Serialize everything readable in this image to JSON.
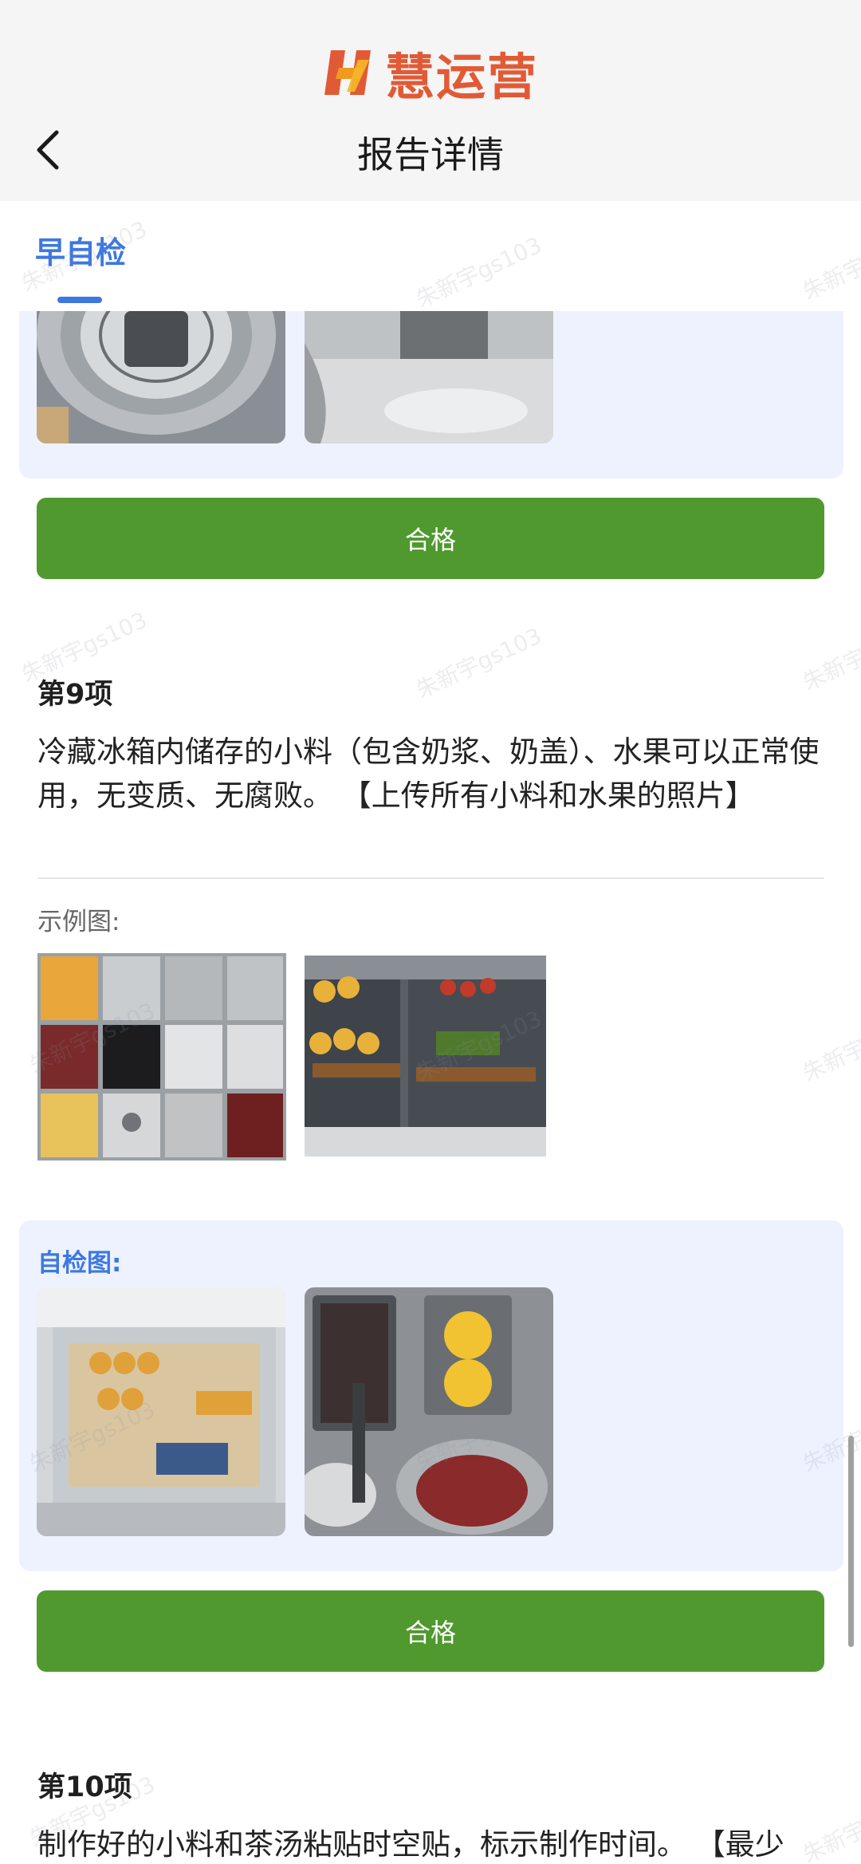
{
  "brand": {
    "name": "慧运营",
    "accent": "#e25a35"
  },
  "header": {
    "title": "报告详情",
    "back_icon": "chevron-left-icon"
  },
  "tabs": [
    {
      "label": "早自检",
      "active": true
    }
  ],
  "watermark": "朱新宇gs103",
  "items": [
    {
      "result_label": "合格"
    },
    {
      "title": "第9项",
      "description": "冷藏冰箱内储存的小料（包含奶浆、奶盖）、水果可以正常使用，无变质、无腐败。 【上传所有小料和水果的照片】",
      "example_label": "示例图:",
      "self_check_label": "自检图:",
      "result_label": "合格"
    },
    {
      "title": "第10项",
      "description": "制作好的小料和茶汤粘贴时空贴，标示制作时间。 【最少"
    }
  ],
  "colors": {
    "primary_blue": "#3c78e0",
    "pass_green": "#4f992f",
    "panel_bg": "#eef2ff"
  }
}
